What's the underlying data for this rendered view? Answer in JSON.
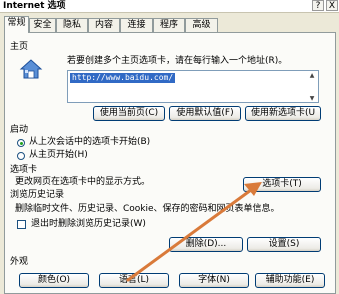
{
  "window": {
    "title": "Internet 选项",
    "help_label": "?",
    "close_label": "X"
  },
  "tabs": [
    {
      "label": "常规"
    },
    {
      "label": "安全"
    },
    {
      "label": "隐私"
    },
    {
      "label": "内容"
    },
    {
      "label": "连接"
    },
    {
      "label": "程序"
    },
    {
      "label": "高级"
    }
  ],
  "homepage": {
    "heading": "主页",
    "instruction": "若要创建多个主页选项卡，请在每行输入一个地址(R)。",
    "url": "http://www.baidu.com/",
    "use_current": "使用当前页(C)",
    "use_default": "使用默认值(F)",
    "use_new_tab": "使用新选项卡(U"
  },
  "startup": {
    "heading": "启动",
    "option_last_session": "从上次会话中的选项卡开始(B)",
    "option_home": "从主页开始(H)"
  },
  "tabs_section": {
    "heading": "选项卡",
    "description": "更改网页在选项卡中的显示方式。",
    "button": "选项卡(T)"
  },
  "history": {
    "heading": "浏览历史记录",
    "description": "删除临时文件、历史记录、Cookie、保存的密码和网页表单信息。",
    "checkbox_label": "退出时删除浏览历史记录(W)",
    "delete_button": "删除(D)...",
    "settings_button": "设置(S)"
  },
  "appearance": {
    "heading": "外观",
    "colors_button": "颜色(O)",
    "languages_button": "语言(L)",
    "fonts_button": "字体(N)",
    "accessibility_button": "辅助功能(E)"
  },
  "annotation": {
    "arrow_color": "#d97a3a"
  }
}
